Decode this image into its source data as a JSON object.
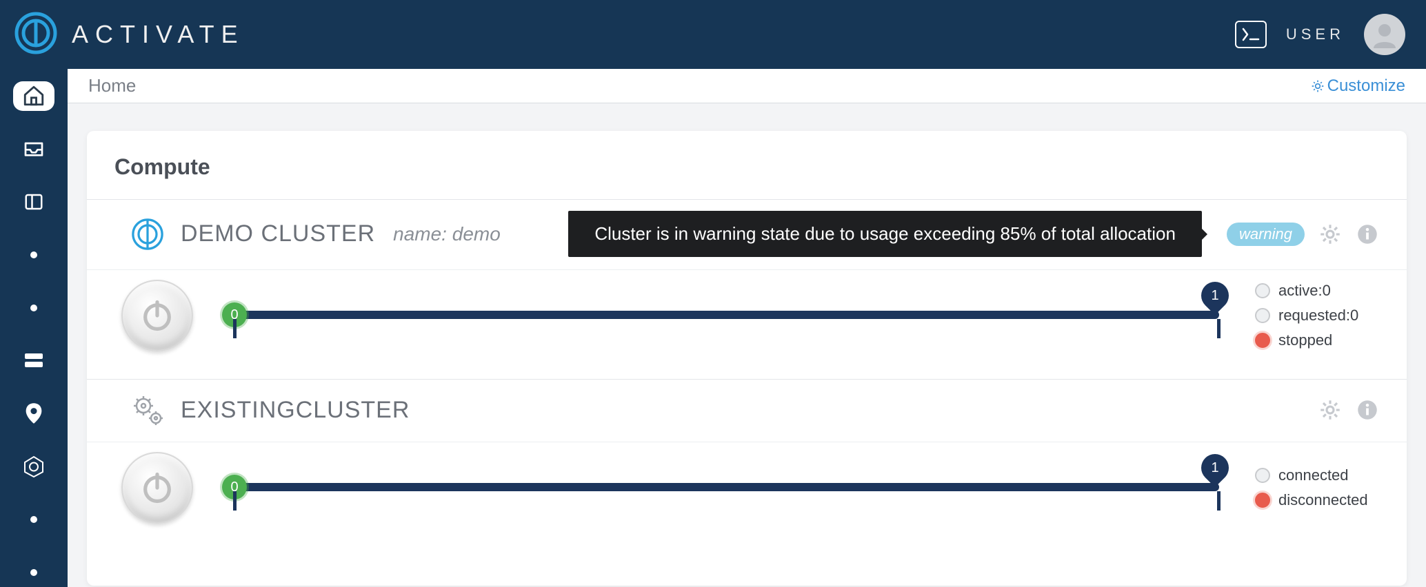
{
  "header": {
    "brand": "ACTIVATE",
    "user_label": "USER"
  },
  "breadcrumb": "Home",
  "customize_label": "Customize",
  "section_title": "Compute",
  "clusters": [
    {
      "title": "DEMO CLUSTER",
      "subtitle": "name: demo",
      "tooltip": "Cluster is in warning state due to usage exceeding 85% of total allocation",
      "badge": "warning",
      "slider": {
        "start": "0",
        "end": "1"
      },
      "legend": [
        {
          "label": "active:0",
          "color": "grey"
        },
        {
          "label": "requested:0",
          "color": "grey"
        },
        {
          "label": "stopped",
          "color": "red"
        }
      ]
    },
    {
      "title": "EXISTINGCLUSTER",
      "subtitle": "",
      "tooltip": "",
      "badge": "",
      "slider": {
        "start": "0",
        "end": "1"
      },
      "legend": [
        {
          "label": "connected",
          "color": "grey"
        },
        {
          "label": "disconnected",
          "color": "red"
        }
      ]
    }
  ]
}
